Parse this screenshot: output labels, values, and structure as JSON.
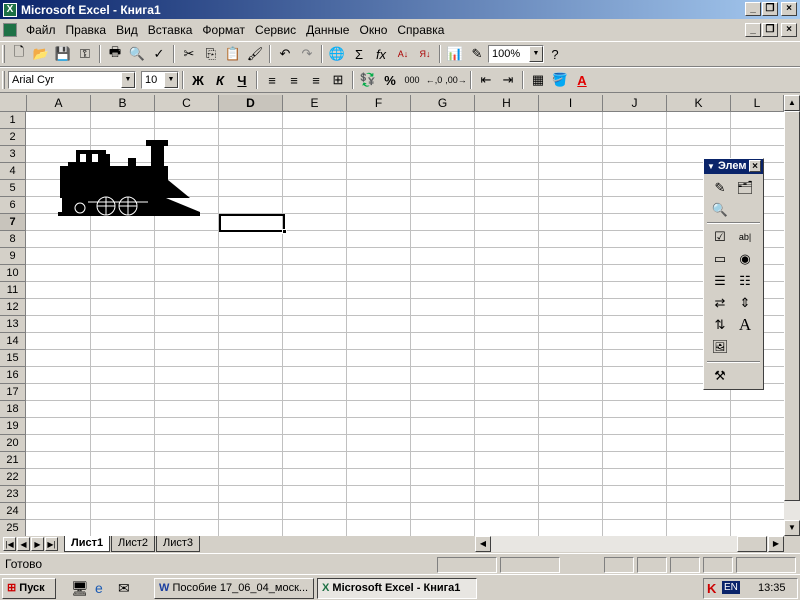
{
  "window": {
    "title": "Microsoft Excel - Книга1"
  },
  "menu": {
    "items": [
      "Файл",
      "Правка",
      "Вид",
      "Вставка",
      "Формат",
      "Сервис",
      "Данные",
      "Окно",
      "Справка"
    ]
  },
  "toolbar_standard": {
    "zoom": "100%"
  },
  "toolbar_format": {
    "font": "Arial Cyr",
    "size": "10",
    "bold_label": "Ж",
    "italic_label": "К",
    "underline_label": "Ч",
    "percent_label": "%",
    "thousands_label": "000"
  },
  "sheet": {
    "columns": [
      "A",
      "B",
      "C",
      "D",
      "E",
      "F",
      "G",
      "H",
      "I",
      "J",
      "K",
      "L"
    ],
    "rows": [
      "1",
      "2",
      "3",
      "4",
      "5",
      "6",
      "7",
      "8",
      "9",
      "10",
      "11",
      "12",
      "13",
      "14",
      "15",
      "16",
      "17",
      "18",
      "19",
      "20",
      "21",
      "22",
      "23",
      "24",
      "25"
    ],
    "selected_cell": "D7",
    "tabs": [
      "Лист1",
      "Лист2",
      "Лист3"
    ],
    "active_tab": "Лист1"
  },
  "forms_toolbar": {
    "title": "Элем"
  },
  "status": {
    "text": "Готово"
  },
  "taskbar": {
    "start": "Пуск",
    "task1": "Пособие 17_06_04_моск...",
    "task2": "Microsoft Excel - Книга1",
    "lang": "EN",
    "time": "13:35"
  },
  "colors": {
    "titlebar": "#0a246a",
    "face": "#d4d0c8",
    "grid": "#c0c0c0"
  }
}
